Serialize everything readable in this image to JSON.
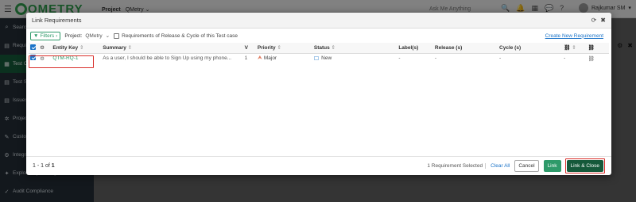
{
  "app": {
    "logo_text": "QMETRY",
    "project_label": "Project",
    "project_value": "QMetry",
    "ask_placeholder": "Ask Me Anything",
    "notification_count": "",
    "user_name": "Rajkumar SM"
  },
  "sidebar": {
    "items": [
      {
        "label": "Search",
        "icon": "search-icon"
      },
      {
        "label": "Requirements",
        "icon": "requirements-icon"
      },
      {
        "label": "Test Cases",
        "icon": "testcases-icon",
        "active": true
      },
      {
        "label": "Test Suites",
        "icon": "testsuites-icon"
      },
      {
        "label": "Issues",
        "icon": "issues-icon"
      },
      {
        "label": "Projects",
        "icon": "projects-icon"
      },
      {
        "label": "Customization",
        "icon": "customization-icon"
      },
      {
        "label": "Integrations",
        "icon": "integrations-icon"
      },
      {
        "label": "Exploratory Testing",
        "icon": "exploratory-icon"
      },
      {
        "label": "Audit Compliance",
        "icon": "audit-icon"
      }
    ]
  },
  "modal": {
    "title": "Link Requirements",
    "filters_label": "Filters",
    "project_label": "Project:",
    "project_value": "QMetry",
    "requirements_checkbox_label": "Requirements of Release & Cycle of this Test case",
    "create_link": "Create New Requirement",
    "columns": {
      "entity_key": "Entity Key",
      "summary": "Summary",
      "version": "V",
      "priority": "Priority",
      "status": "Status",
      "labels": "Label(s)",
      "release": "Release (s)",
      "cycle": "Cycle (s)"
    },
    "rows": [
      {
        "selected": true,
        "entity_key": "QTM-RQ-1",
        "summary": "As a user, I should be able to Sign Up using my phone...",
        "version": "1",
        "priority": "Major",
        "status": "New",
        "labels": "-",
        "release": "-",
        "cycle": "-",
        "count": "-"
      }
    ],
    "footer": {
      "pager_prefix": "1 - 1",
      "pager_of": "of",
      "pager_total": "1",
      "selected_count": "1 Requirement Selected",
      "clear_all": "Clear All",
      "cancel": "Cancel",
      "link": "Link",
      "link_close": "Link & Close"
    }
  },
  "colors": {
    "brand_green": "#2e9a6a",
    "dark_green": "#15593a",
    "link_blue": "#1a73c8",
    "highlight_red": "#d9302c"
  }
}
